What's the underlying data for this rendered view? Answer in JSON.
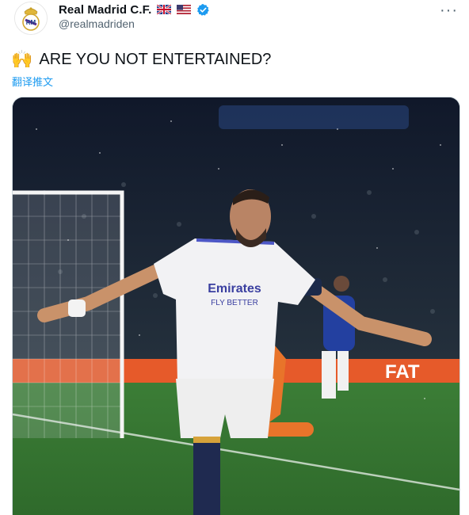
{
  "tweet": {
    "author": {
      "display_name": "Real Madrid C.F.",
      "handle": "@realmadriden",
      "flags": [
        "uk-flag-icon",
        "us-flag-icon"
      ],
      "verified": true
    },
    "text": "ARE YOU NOT ENTERTAINED?",
    "emoji": "🙌",
    "translate_label": "翻译推文",
    "media": {
      "type": "photo",
      "shirt_sponsor_line1": "Emirates",
      "shirt_sponsor_line2": "FLY BETTER",
      "board_text": "FAT"
    }
  },
  "colors": {
    "link": "#1d9bf0",
    "secondary_text": "#536471",
    "pitch": "#3f7a36",
    "board": "#e65a2a"
  }
}
